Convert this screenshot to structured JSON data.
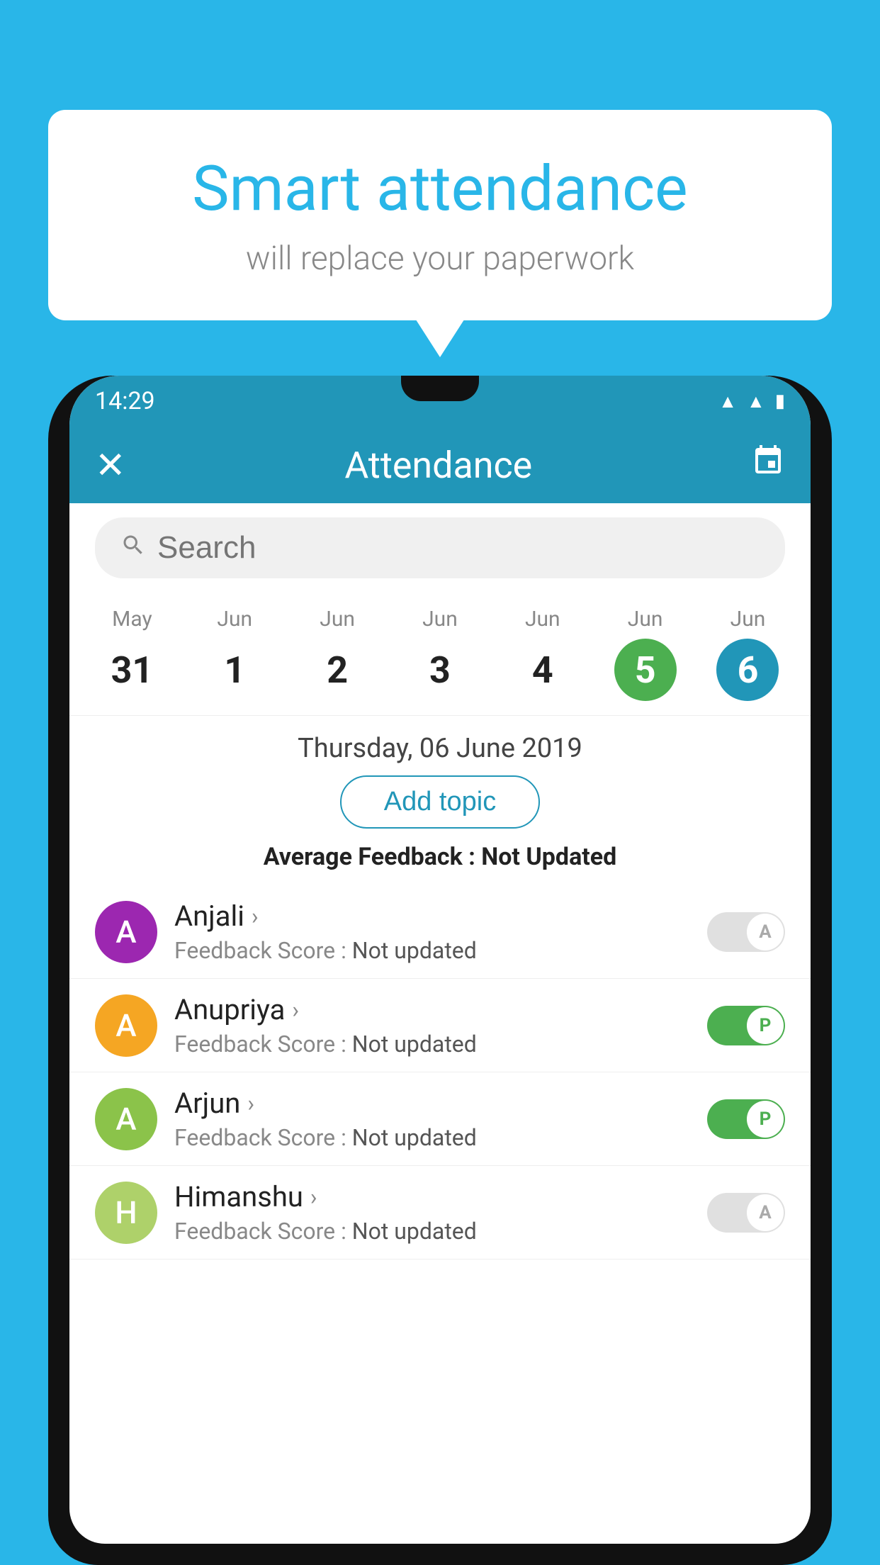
{
  "background_color": "#29b6e8",
  "speech_bubble": {
    "title": "Smart attendance",
    "subtitle": "will replace your paperwork"
  },
  "status_bar": {
    "time": "14:29",
    "icons": [
      "wifi",
      "signal",
      "battery"
    ]
  },
  "app_bar": {
    "title": "Attendance",
    "close_icon": "✕",
    "calendar_icon": "📅"
  },
  "search": {
    "placeholder": "Search"
  },
  "calendar": {
    "days": [
      {
        "month": "May",
        "day": "31",
        "selected": false
      },
      {
        "month": "Jun",
        "day": "1",
        "selected": false
      },
      {
        "month": "Jun",
        "day": "2",
        "selected": false
      },
      {
        "month": "Jun",
        "day": "3",
        "selected": false
      },
      {
        "month": "Jun",
        "day": "4",
        "selected": false
      },
      {
        "month": "Jun",
        "day": "5",
        "selected": "green"
      },
      {
        "month": "Jun",
        "day": "6",
        "selected": "blue"
      }
    ]
  },
  "selected_date": "Thursday, 06 June 2019",
  "add_topic_label": "Add topic",
  "avg_feedback_label": "Average Feedback :",
  "avg_feedback_value": "Not Updated",
  "students": [
    {
      "name": "Anjali",
      "avatar_letter": "A",
      "avatar_color": "#9c27b0",
      "score_label": "Feedback Score :",
      "score_value": "Not updated",
      "toggle": "off",
      "toggle_letter": "A"
    },
    {
      "name": "Anupriya",
      "avatar_letter": "A",
      "avatar_color": "#f5a623",
      "score_label": "Feedback Score :",
      "score_value": "Not updated",
      "toggle": "on",
      "toggle_letter": "P"
    },
    {
      "name": "Arjun",
      "avatar_letter": "A",
      "avatar_color": "#8bc34a",
      "score_label": "Feedback Score :",
      "score_value": "Not updated",
      "toggle": "on",
      "toggle_letter": "P"
    },
    {
      "name": "Himanshu",
      "avatar_letter": "H",
      "avatar_color": "#aed16a",
      "score_label": "Feedback Score :",
      "score_value": "Not updated",
      "toggle": "off",
      "toggle_letter": "A"
    }
  ]
}
